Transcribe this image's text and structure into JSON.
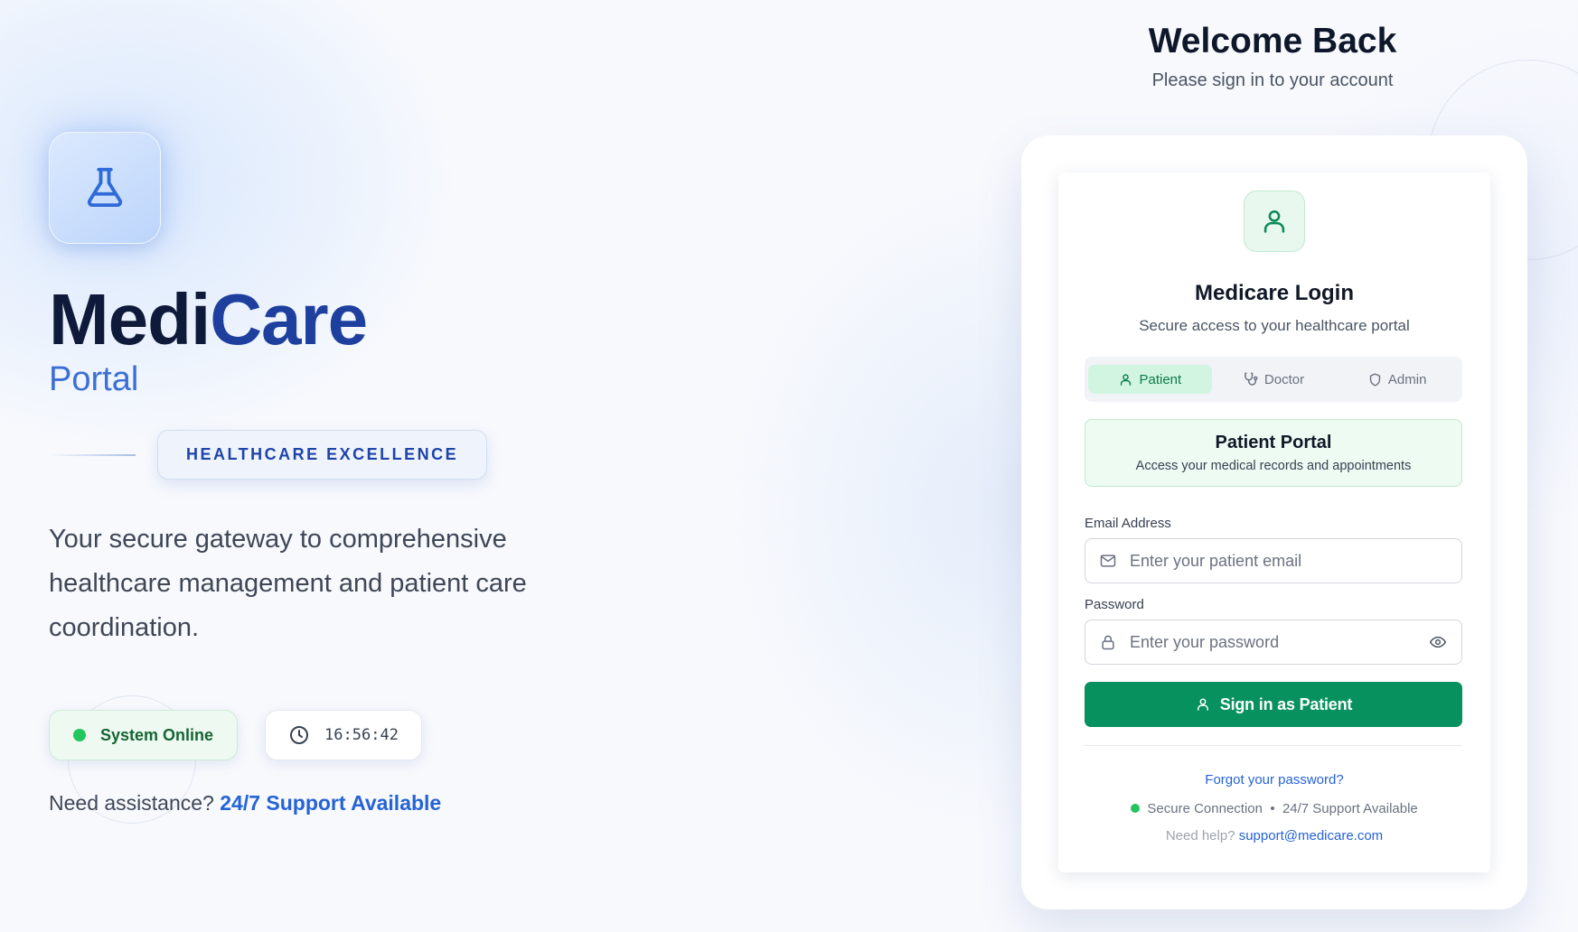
{
  "hero": {
    "brand_part1": "Medi",
    "brand_part2": "Care",
    "brand_sub": "Portal",
    "tagline": "HEALTHCARE EXCELLENCE",
    "description": "Your secure gateway to comprehensive healthcare management and patient care coordination.",
    "status_online": "System Online",
    "clock": "16:56:42",
    "assist_prefix": "Need assistance?",
    "assist_link": "24/7 Support Available"
  },
  "welcome": {
    "title": "Welcome Back",
    "subtitle": "Please sign in to your account"
  },
  "card": {
    "title": "Medicare Login",
    "subtitle": "Secure access to your healthcare portal",
    "roles": [
      {
        "label": "Patient",
        "icon": "user-icon",
        "active": true
      },
      {
        "label": "Doctor",
        "icon": "stethoscope-icon",
        "active": false
      },
      {
        "label": "Admin",
        "icon": "shield-icon",
        "active": false
      }
    ],
    "portal_title": "Patient Portal",
    "portal_desc": "Access your medical records and appointments",
    "email_label": "Email Address",
    "email_placeholder": "Enter your patient email",
    "email_value": "",
    "password_label": "Password",
    "password_placeholder": "Enter your password",
    "password_value": "",
    "submit_label": "Sign in as Patient",
    "forgot_label": "Forgot your password?",
    "secure_label": "Secure Connection",
    "separator": "•",
    "support_label": "24/7 Support Available",
    "help_prefix": "Need help?",
    "help_email": "support@medicare.com"
  },
  "colors": {
    "accent_green": "#07915e",
    "brand_blue": "#1e3f9e",
    "link_blue": "#2563d6",
    "online_green": "#22c55e"
  }
}
